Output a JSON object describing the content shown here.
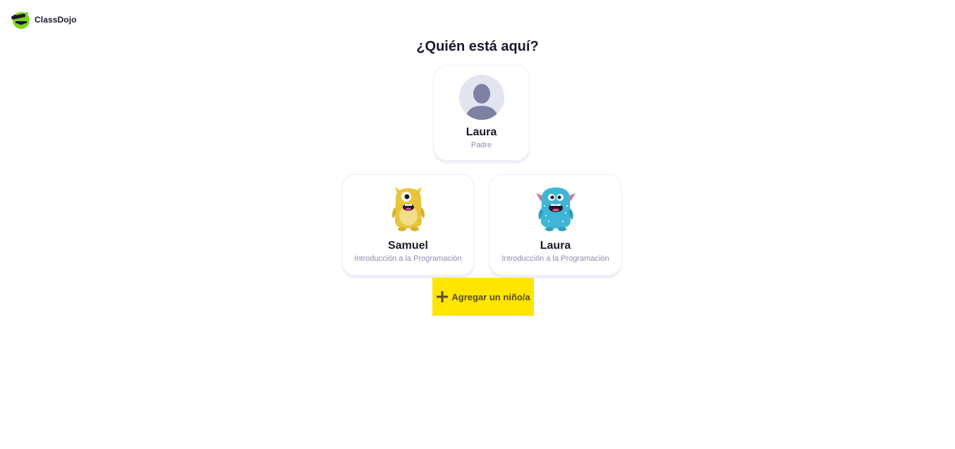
{
  "header": {
    "logo_text": "ClassDojo"
  },
  "page": {
    "title": "¿Quién está aquí?"
  },
  "profiles": {
    "parent": {
      "name": "Laura",
      "role": "Padre"
    },
    "children": [
      {
        "name": "Samuel",
        "class": "Introducción a la Programación",
        "avatar": "yellow-monster",
        "color": "#e8c53a"
      },
      {
        "name": "Laura",
        "class": "Introducción a la Programación",
        "avatar": "blue-monster",
        "color": "#3fb6d6"
      }
    ]
  },
  "actions": {
    "add_child_label": "Agregar un niño/a"
  },
  "colors": {
    "accent_yellow": "#ffe500",
    "logo_green": "#7ed321",
    "text_dark": "#1a192b",
    "text_muted": "#8b8fa8",
    "avatar_bg": "#e2e4f0",
    "avatar_fg": "#7d7fa3"
  }
}
